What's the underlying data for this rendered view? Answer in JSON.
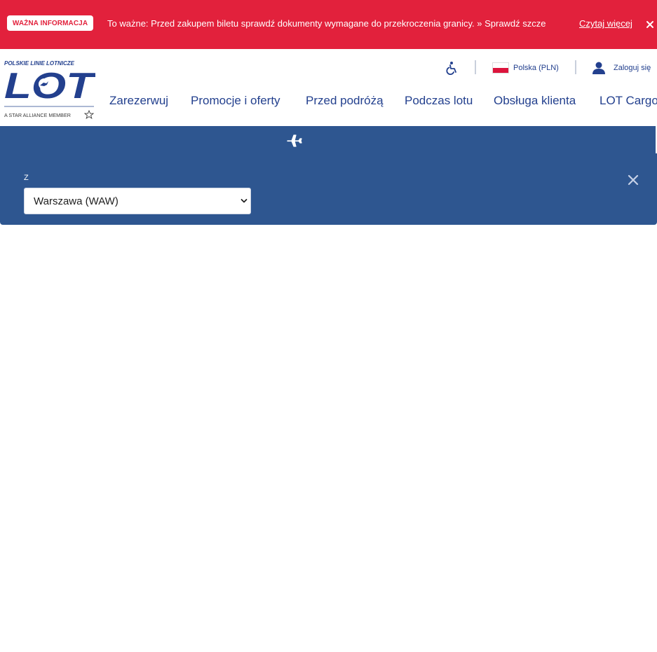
{
  "alert": {
    "badge": "WAŻNA INFORMACJA",
    "message": "To ważne: Przed zakupem biletu sprawdź dokumenty wymagane do przekroczenia granicy. » Sprawdź szcze",
    "link": "Czytaj więcej",
    "close_icon": "close-icon"
  },
  "logo": {
    "top_text": "POLSKIE LINIE LOTNICZE",
    "brand": "LOT",
    "alliance": "A STAR ALLIANCE MEMBER"
  },
  "utility": {
    "accessibility_icon": "wheelchair-icon",
    "language": "Polska (PLN)",
    "login": "Zaloguj się"
  },
  "nav": [
    "Zarezerwuj",
    "Promocje i oferty",
    "Przed podróżą",
    "Podczas lotu",
    "Obsługa klienta",
    "LOT Cargo"
  ],
  "booking": {
    "tab_icon": "airplane-icon",
    "from_label": "Z",
    "from_value": "Warszawa (WAW)",
    "close_icon": "close-icon"
  },
  "colors": {
    "alert_red": "#e2213c",
    "brand_navy": "#23408e",
    "panel_blue": "#2e5690"
  }
}
